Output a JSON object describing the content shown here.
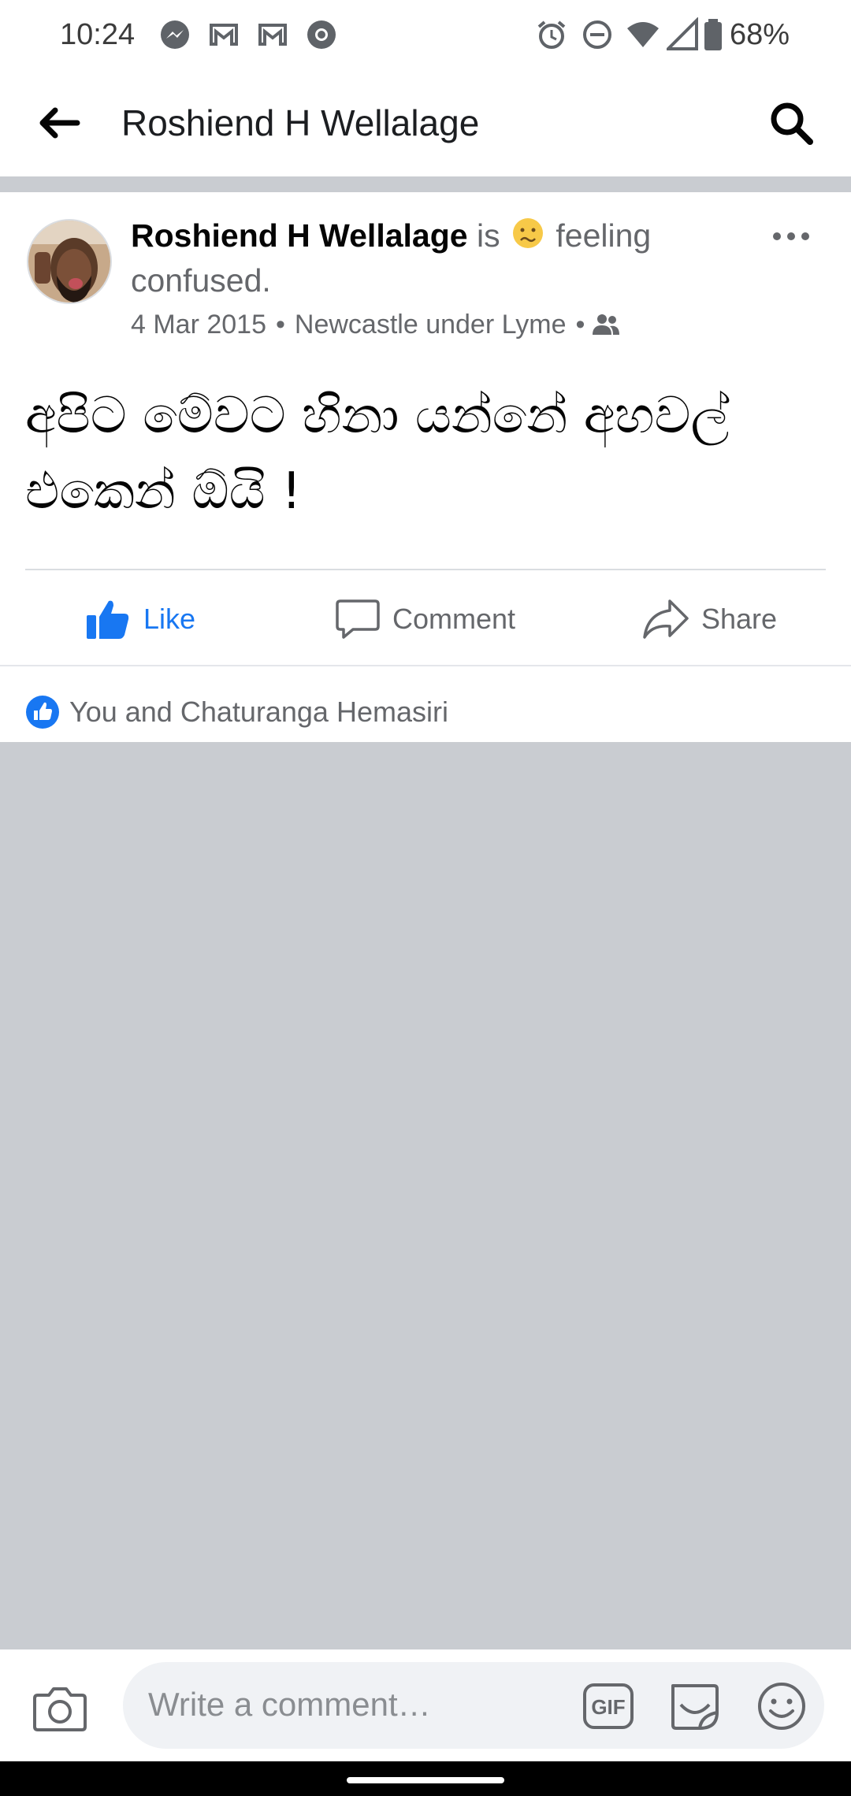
{
  "status_bar": {
    "time": "10:24",
    "battery_pct": "68%",
    "notification_icons": [
      "messenger-icon",
      "gmail-icon",
      "gmail-icon",
      "chrome-icon"
    ],
    "system_icons": [
      "alarm-icon",
      "dnd-icon",
      "wifi-icon",
      "signal-icon",
      "battery-icon"
    ]
  },
  "header": {
    "title": "Roshiend H Wellalage"
  },
  "post": {
    "author": "Roshiend H Wellalage",
    "is_text": "is",
    "feeling_text": "feeling confused.",
    "date": "4 Mar 2015",
    "location": "Newcastle under Lyme",
    "body": "අපිට මේවට හිනා යන්නේ අහවල් එකෙන් ඕයි !",
    "actions": {
      "like": "Like",
      "comment": "Comment",
      "share": "Share"
    },
    "reactions_text": "You and Chaturanga Hemasiri"
  },
  "comment_bar": {
    "placeholder": "Write a comment…",
    "gif_label": "GIF"
  },
  "colors": {
    "brand_blue": "#1877f2",
    "secondary_text": "#65676b",
    "divider_gray": "#c9ccd1"
  }
}
